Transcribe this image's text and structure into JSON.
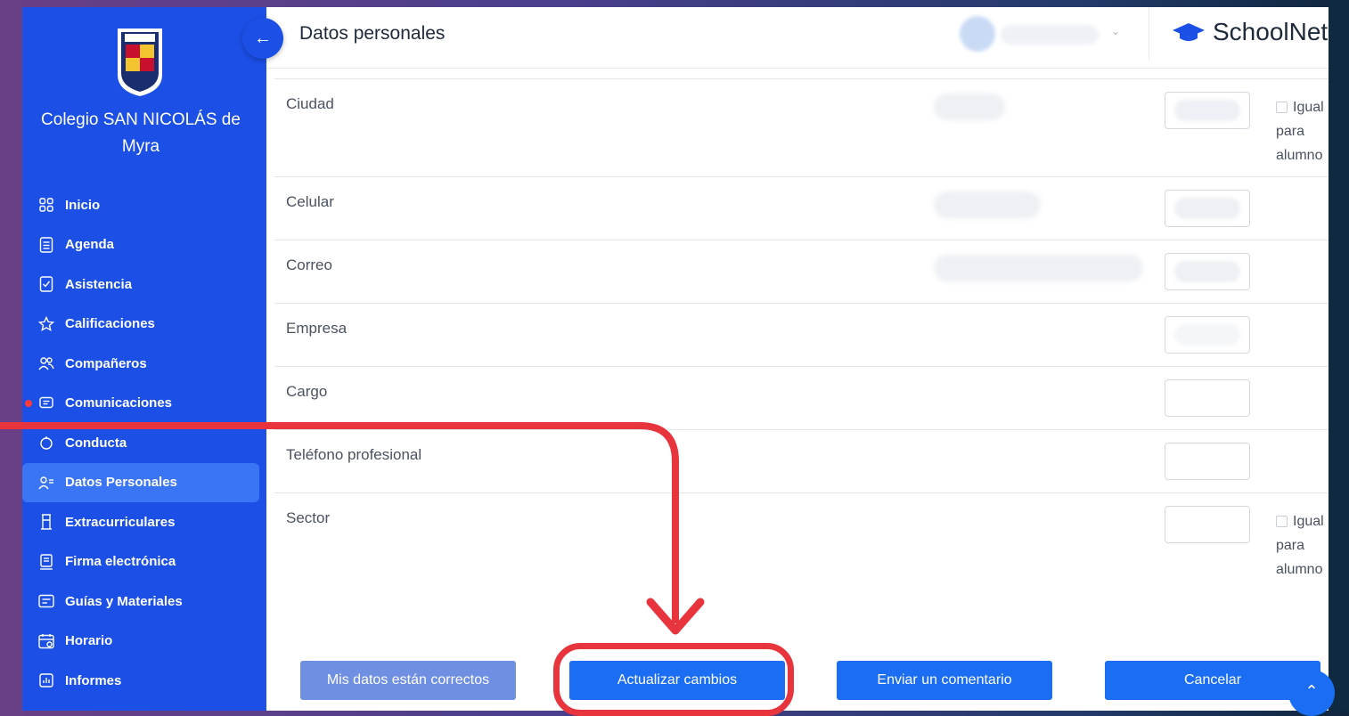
{
  "school": {
    "name": "Colegio SAN NICOLÁS de Myra",
    "logo_text": "SAN NICOLÁS"
  },
  "header": {
    "title": "Datos personales",
    "brand": "SchoolNet"
  },
  "nav": [
    {
      "label": "Inicio",
      "icon": "grid-icon"
    },
    {
      "label": "Agenda",
      "icon": "document-icon"
    },
    {
      "label": "Asistencia",
      "icon": "checklist-icon"
    },
    {
      "label": "Calificaciones",
      "icon": "star-icon"
    },
    {
      "label": "Compañeros",
      "icon": "people-icon"
    },
    {
      "label": "Comunicaciones",
      "icon": "message-icon"
    },
    {
      "label": "Conducta",
      "icon": "circle-icon"
    },
    {
      "label": "Datos Personales",
      "icon": "person-card-icon"
    },
    {
      "label": "Extracurriculares",
      "icon": "tower-icon"
    },
    {
      "label": "Firma electrónica",
      "icon": "signature-icon"
    },
    {
      "label": "Guías y Materiales",
      "icon": "folder-icon"
    },
    {
      "label": "Horario",
      "icon": "calendar-icon"
    },
    {
      "label": "Informes",
      "icon": "report-icon"
    }
  ],
  "form": {
    "rows": [
      {
        "label": "Ciudad",
        "same_label": "Igual para alumno"
      },
      {
        "label": "Celular"
      },
      {
        "label": "Correo"
      },
      {
        "label": "Empresa"
      },
      {
        "label": "Cargo"
      },
      {
        "label": "Teléfono profesional"
      },
      {
        "label": "Sector",
        "same_label": "Igual para alumno"
      }
    ]
  },
  "buttons": {
    "confirm": "Mis datos están correctos",
    "update": "Actualizar cambios",
    "comment": "Enviar un comentario",
    "cancel": "Cancelar"
  },
  "colors": {
    "sidebar": "#1b4fe6",
    "primary": "#1b6ef3",
    "annotation": "#e8343d"
  }
}
